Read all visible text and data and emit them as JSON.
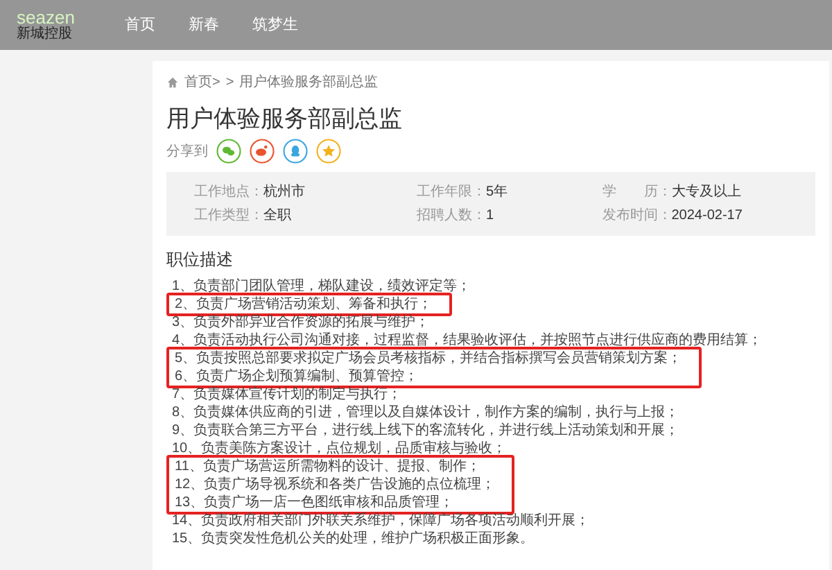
{
  "header": {
    "logo": {
      "wordmark": "seazen",
      "company": "新城控股"
    },
    "nav": [
      {
        "label": "首页",
        "selected": false
      },
      {
        "label": "新春",
        "selected": false
      },
      {
        "label": "筑梦生",
        "selected": false
      }
    ]
  },
  "breadcrumb": {
    "home": "首页>",
    "separator": ">",
    "current": "用户体验服务部副总监"
  },
  "job": {
    "title": "用户体验服务部副总监",
    "share_label": "分享到",
    "share": [
      {
        "kind": "wechat",
        "color": "#5fb832"
      },
      {
        "kind": "weibo",
        "color": "#e8542e"
      },
      {
        "kind": "qq",
        "color": "#3aa6e0"
      },
      {
        "kind": "star",
        "color": "#f2b21c"
      }
    ],
    "info": [
      {
        "label": "工作地点：",
        "value": "杭州市"
      },
      {
        "label": "工作年限：",
        "value": "5年"
      },
      {
        "label": "学　　历：",
        "value": "大专及以上"
      },
      {
        "label": "工作类型：",
        "value": "全职"
      },
      {
        "label": "招聘人数：",
        "value": "1"
      },
      {
        "label": "发布时间：",
        "value": "2024-02-17"
      }
    ]
  },
  "description": {
    "heading": "职位描述",
    "items": [
      {
        "text": "1、负责部门团队管理，梯队建设，绩效评定等；",
        "marked": false
      },
      {
        "text": "2、负责广场营销活动策划、筹备和执行；",
        "marked": true
      },
      {
        "text": "3、负责外部异业合作资源的拓展与维护；",
        "marked": false
      },
      {
        "text": "4、负责活动执行公司沟通对接，过程监督，结果验收评估，并按照节点进行供应商的费用结算；",
        "marked": false
      },
      {
        "text": "5、负责按照总部要求拟定广场会员考核指标，并结合指标撰写会员营销策划方案；",
        "marked": true
      },
      {
        "text": "6、负责广场企划预算编制、预算管控；",
        "marked": true
      },
      {
        "text": "7、负责媒体宣传计划的制定与执行；",
        "marked": false
      },
      {
        "text": "8、负责媒体供应商的引进，管理以及自媒体设计，制作方案的编制，执行与上报；",
        "marked": false
      },
      {
        "text": "9、负责联合第三方平台，进行线上线下的客流转化，并进行线上活动策划和开展；",
        "marked": false
      },
      {
        "text": "10、负责美陈方案设计，点位规划，品质审核与验收；",
        "marked": false
      },
      {
        "text": "11、负责广场营运所需物料的设计、提报、制作；",
        "marked": true
      },
      {
        "text": "12、负责广场导视系统和各类广告设施的点位梳理；",
        "marked": true
      },
      {
        "text": "13、负责广场一店一色图纸审核和品质管理；",
        "marked": true
      },
      {
        "text": "14、负责政府相关部门外联关系维护，保障广场各项活动顺利开展；",
        "marked": false
      },
      {
        "text": "15、负责突发性危机公关的处理，维护广场积极正面形象。",
        "marked": false
      }
    ]
  }
}
